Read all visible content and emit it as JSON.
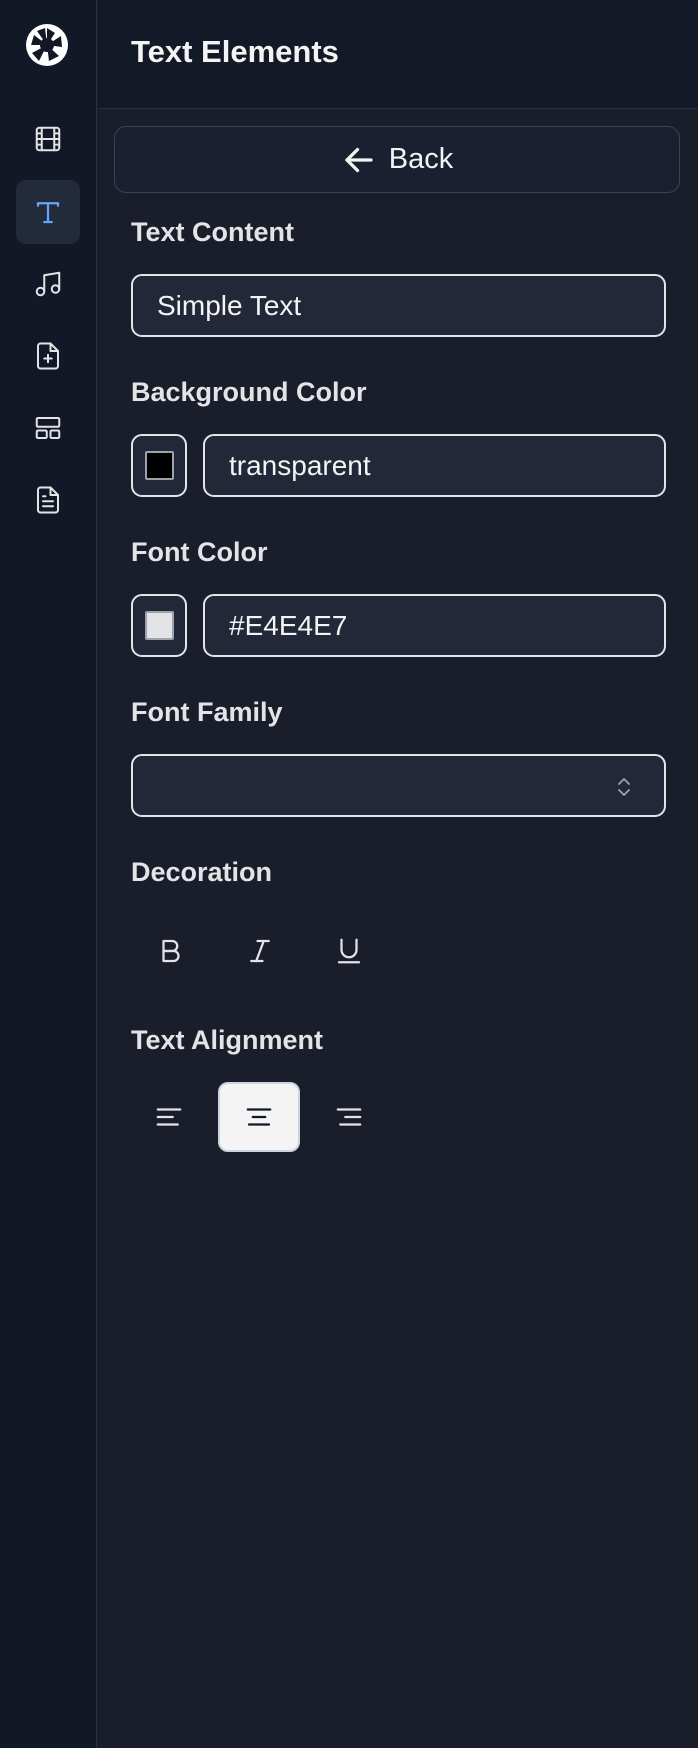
{
  "header": {
    "title": "Text Elements"
  },
  "rail": {
    "items": [
      {
        "icon": "film-icon"
      },
      {
        "icon": "text-icon",
        "active": true
      },
      {
        "icon": "music-icon"
      },
      {
        "icon": "file-plus-icon"
      },
      {
        "icon": "layout-icon"
      },
      {
        "icon": "document-icon"
      }
    ]
  },
  "panel": {
    "back_label": "Back",
    "text_content": {
      "label": "Text Content",
      "value": "Simple Text"
    },
    "background_color": {
      "label": "Background Color",
      "value": "transparent",
      "swatch": "#000000"
    },
    "font_color": {
      "label": "Font Color",
      "value": "#E4E4E7",
      "swatch": "#E4E4E7"
    },
    "font_family": {
      "label": "Font Family",
      "value": ""
    },
    "decoration": {
      "label": "Decoration",
      "options": [
        "bold",
        "italic",
        "underline"
      ]
    },
    "alignment": {
      "label": "Text Alignment",
      "options": [
        "left",
        "center",
        "right"
      ],
      "selected": "center"
    }
  },
  "colors": {
    "accent": "#60a5fa",
    "background": "#1a1e2b",
    "rail": "#131826",
    "text": "#e4e4e7"
  }
}
